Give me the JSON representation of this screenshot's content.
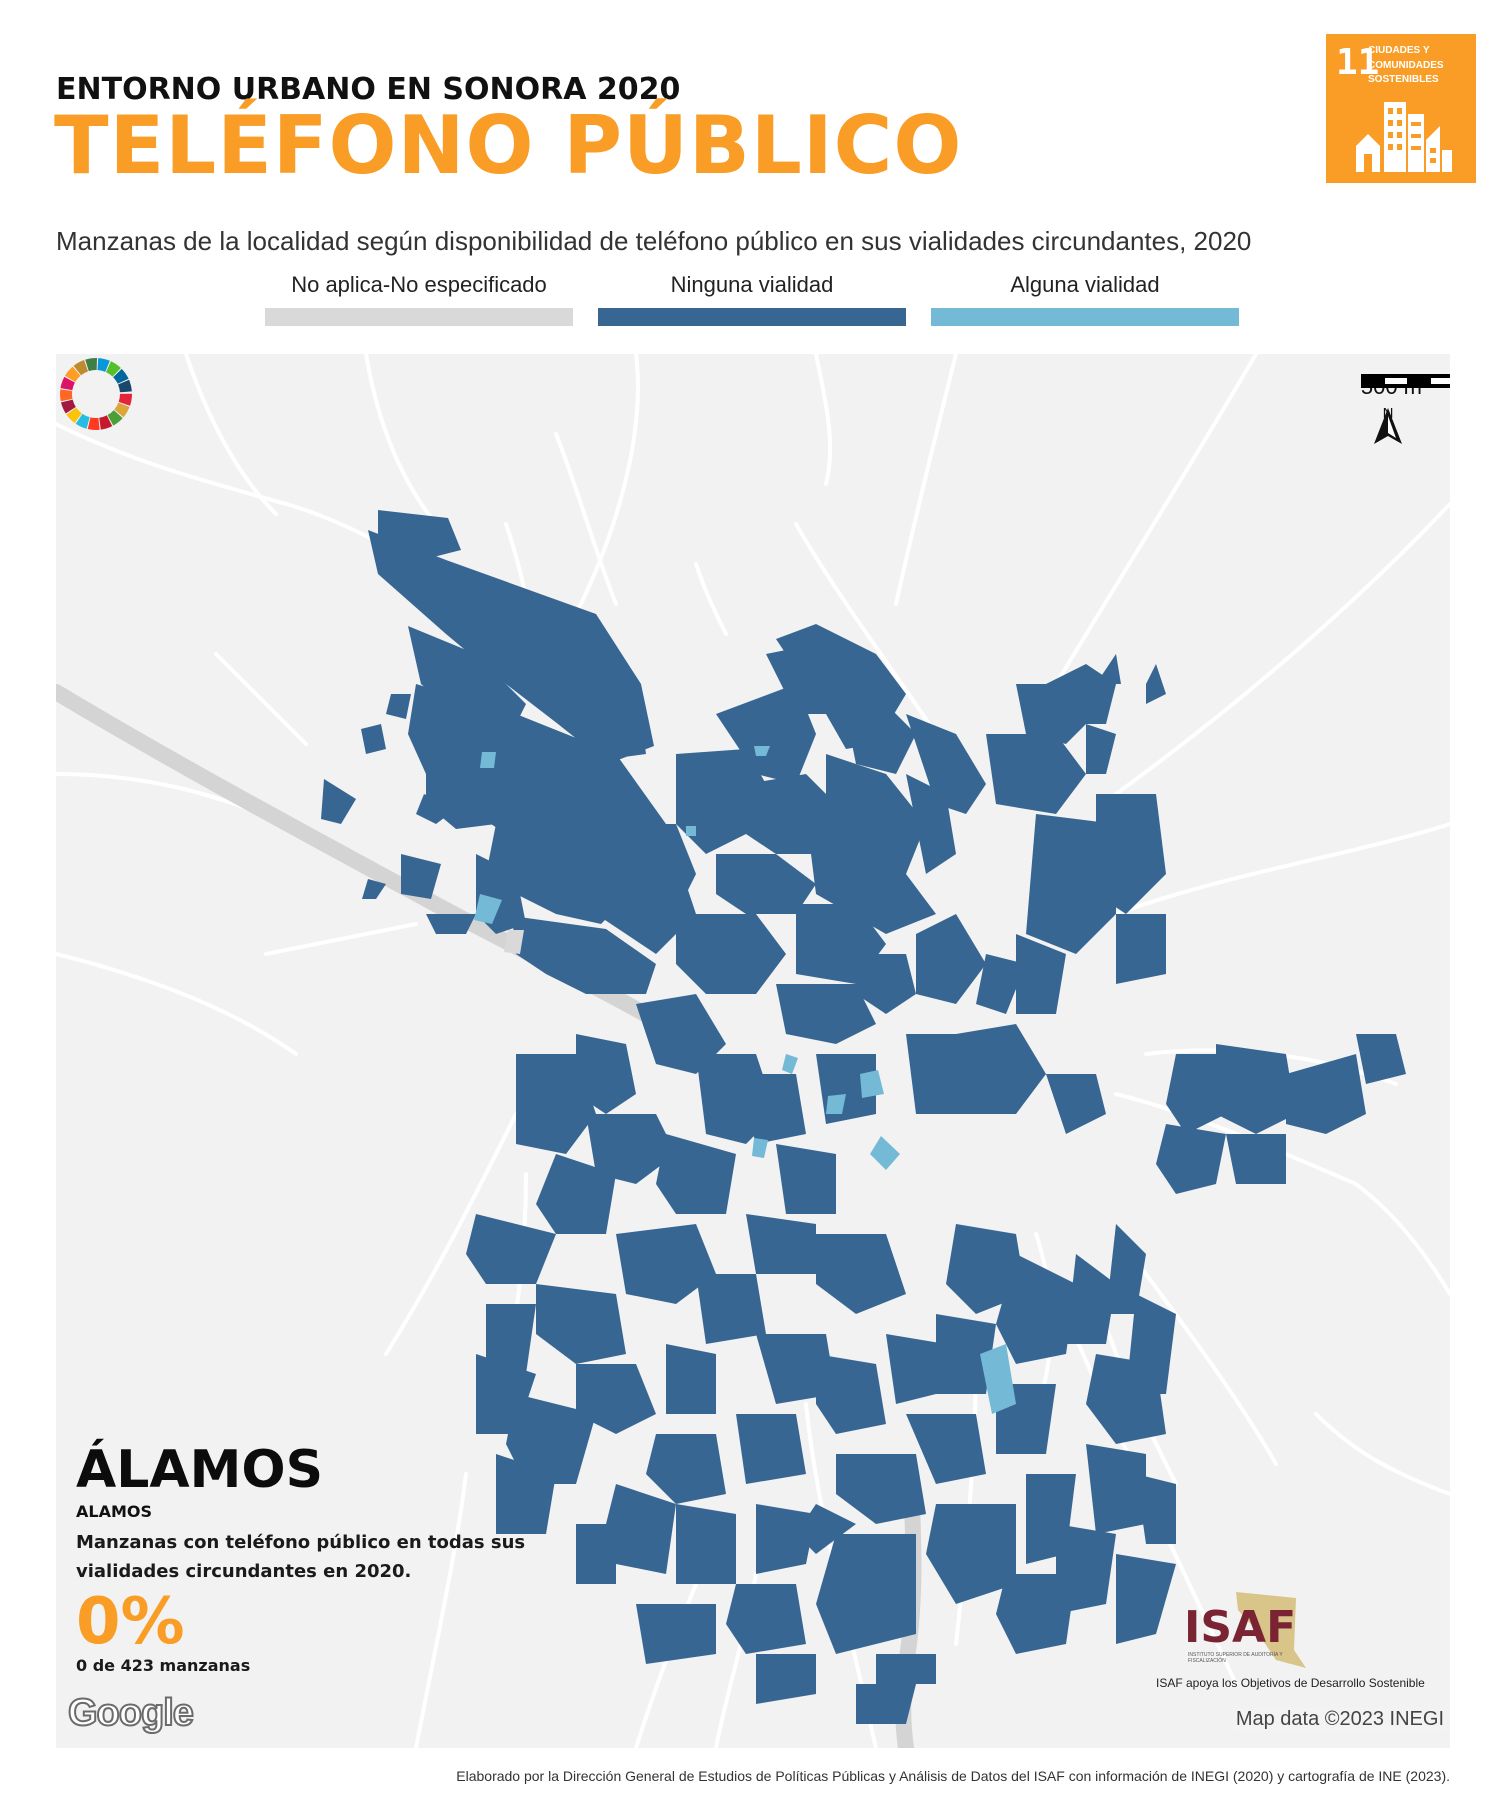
{
  "header": {
    "supertitle": "ENTORNO URBANO EN SONORA 2020",
    "title": "TELÉFONO PÚBLICO"
  },
  "sdg_badge": {
    "number": "11",
    "text": "CIUDADES Y COMUNIDADES SOSTENIBLES",
    "color": "#F99D26"
  },
  "subtitle": "Manzanas de la localidad según disponibilidad de teléfono público en sus vialidades circundantes, 2020",
  "legend": [
    {
      "label": "No aplica-No especificado",
      "color": "#D9D9D9"
    },
    {
      "label": "Ninguna vialidad",
      "color": "#376693"
    },
    {
      "label": "Alguna vialidad",
      "color": "#74B9D6"
    }
  ],
  "map": {
    "scale_label": "500 m",
    "north_label": "N",
    "attribution": "Map data ©2023 INEGI",
    "provider": "Google",
    "background_color": "#F2F2F2",
    "road_color": "#FFFFFF",
    "highway_color": "#D4D4D4"
  },
  "place": {
    "name": "ÁLAMOS",
    "name_plain": "ALAMOS",
    "description": "Manzanas con teléfono público en todas sus vialidades circundantes en 2020.",
    "percent": "0%",
    "count_text": "0 de 423 manzanas"
  },
  "logos": {
    "isaf": "ISAF",
    "isaf_small": "INSTITUTO SUPERIOR DE AUDITORÍA Y FISCALIZACIÓN",
    "caption": "ISAF apoya los Objetivos de Desarrollo Sostenible"
  },
  "footer": "Elaborado por la Dirección General de Estudios de Políticas Públicas y Análisis de Datos del ISAF con información de INEGI (2020) y cartografía de INE (2023)."
}
